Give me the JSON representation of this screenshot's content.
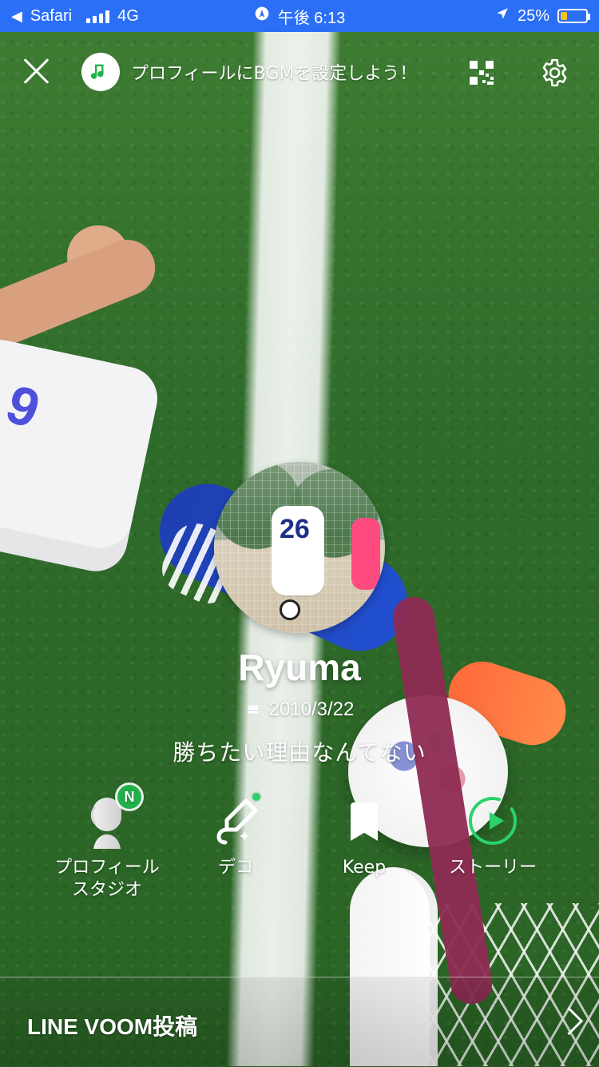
{
  "status_bar": {
    "back_app": "Safari",
    "network": "4G",
    "time": "午後 6:13",
    "battery_percent": "25%"
  },
  "top_bar": {
    "bgm_prompt": "プロフィールにBGMを設定しよう！"
  },
  "profile": {
    "name": "Ryuma",
    "birthday": "2010/3/22",
    "status_message": "勝ちたい理由なんてない"
  },
  "actions": {
    "profile_studio_label_1": "プロフィール",
    "profile_studio_label_2": "スタジオ",
    "profile_studio_badge": "N",
    "deco_label": "デコ",
    "keep_label": "Keep",
    "story_label": "ストーリー"
  },
  "bottom": {
    "voom_label": "LINE VOOM投稿"
  },
  "colors": {
    "status_bar_bg": "#2b6ff6",
    "accent_green": "#21b24b",
    "marker": "#8e2b52"
  }
}
